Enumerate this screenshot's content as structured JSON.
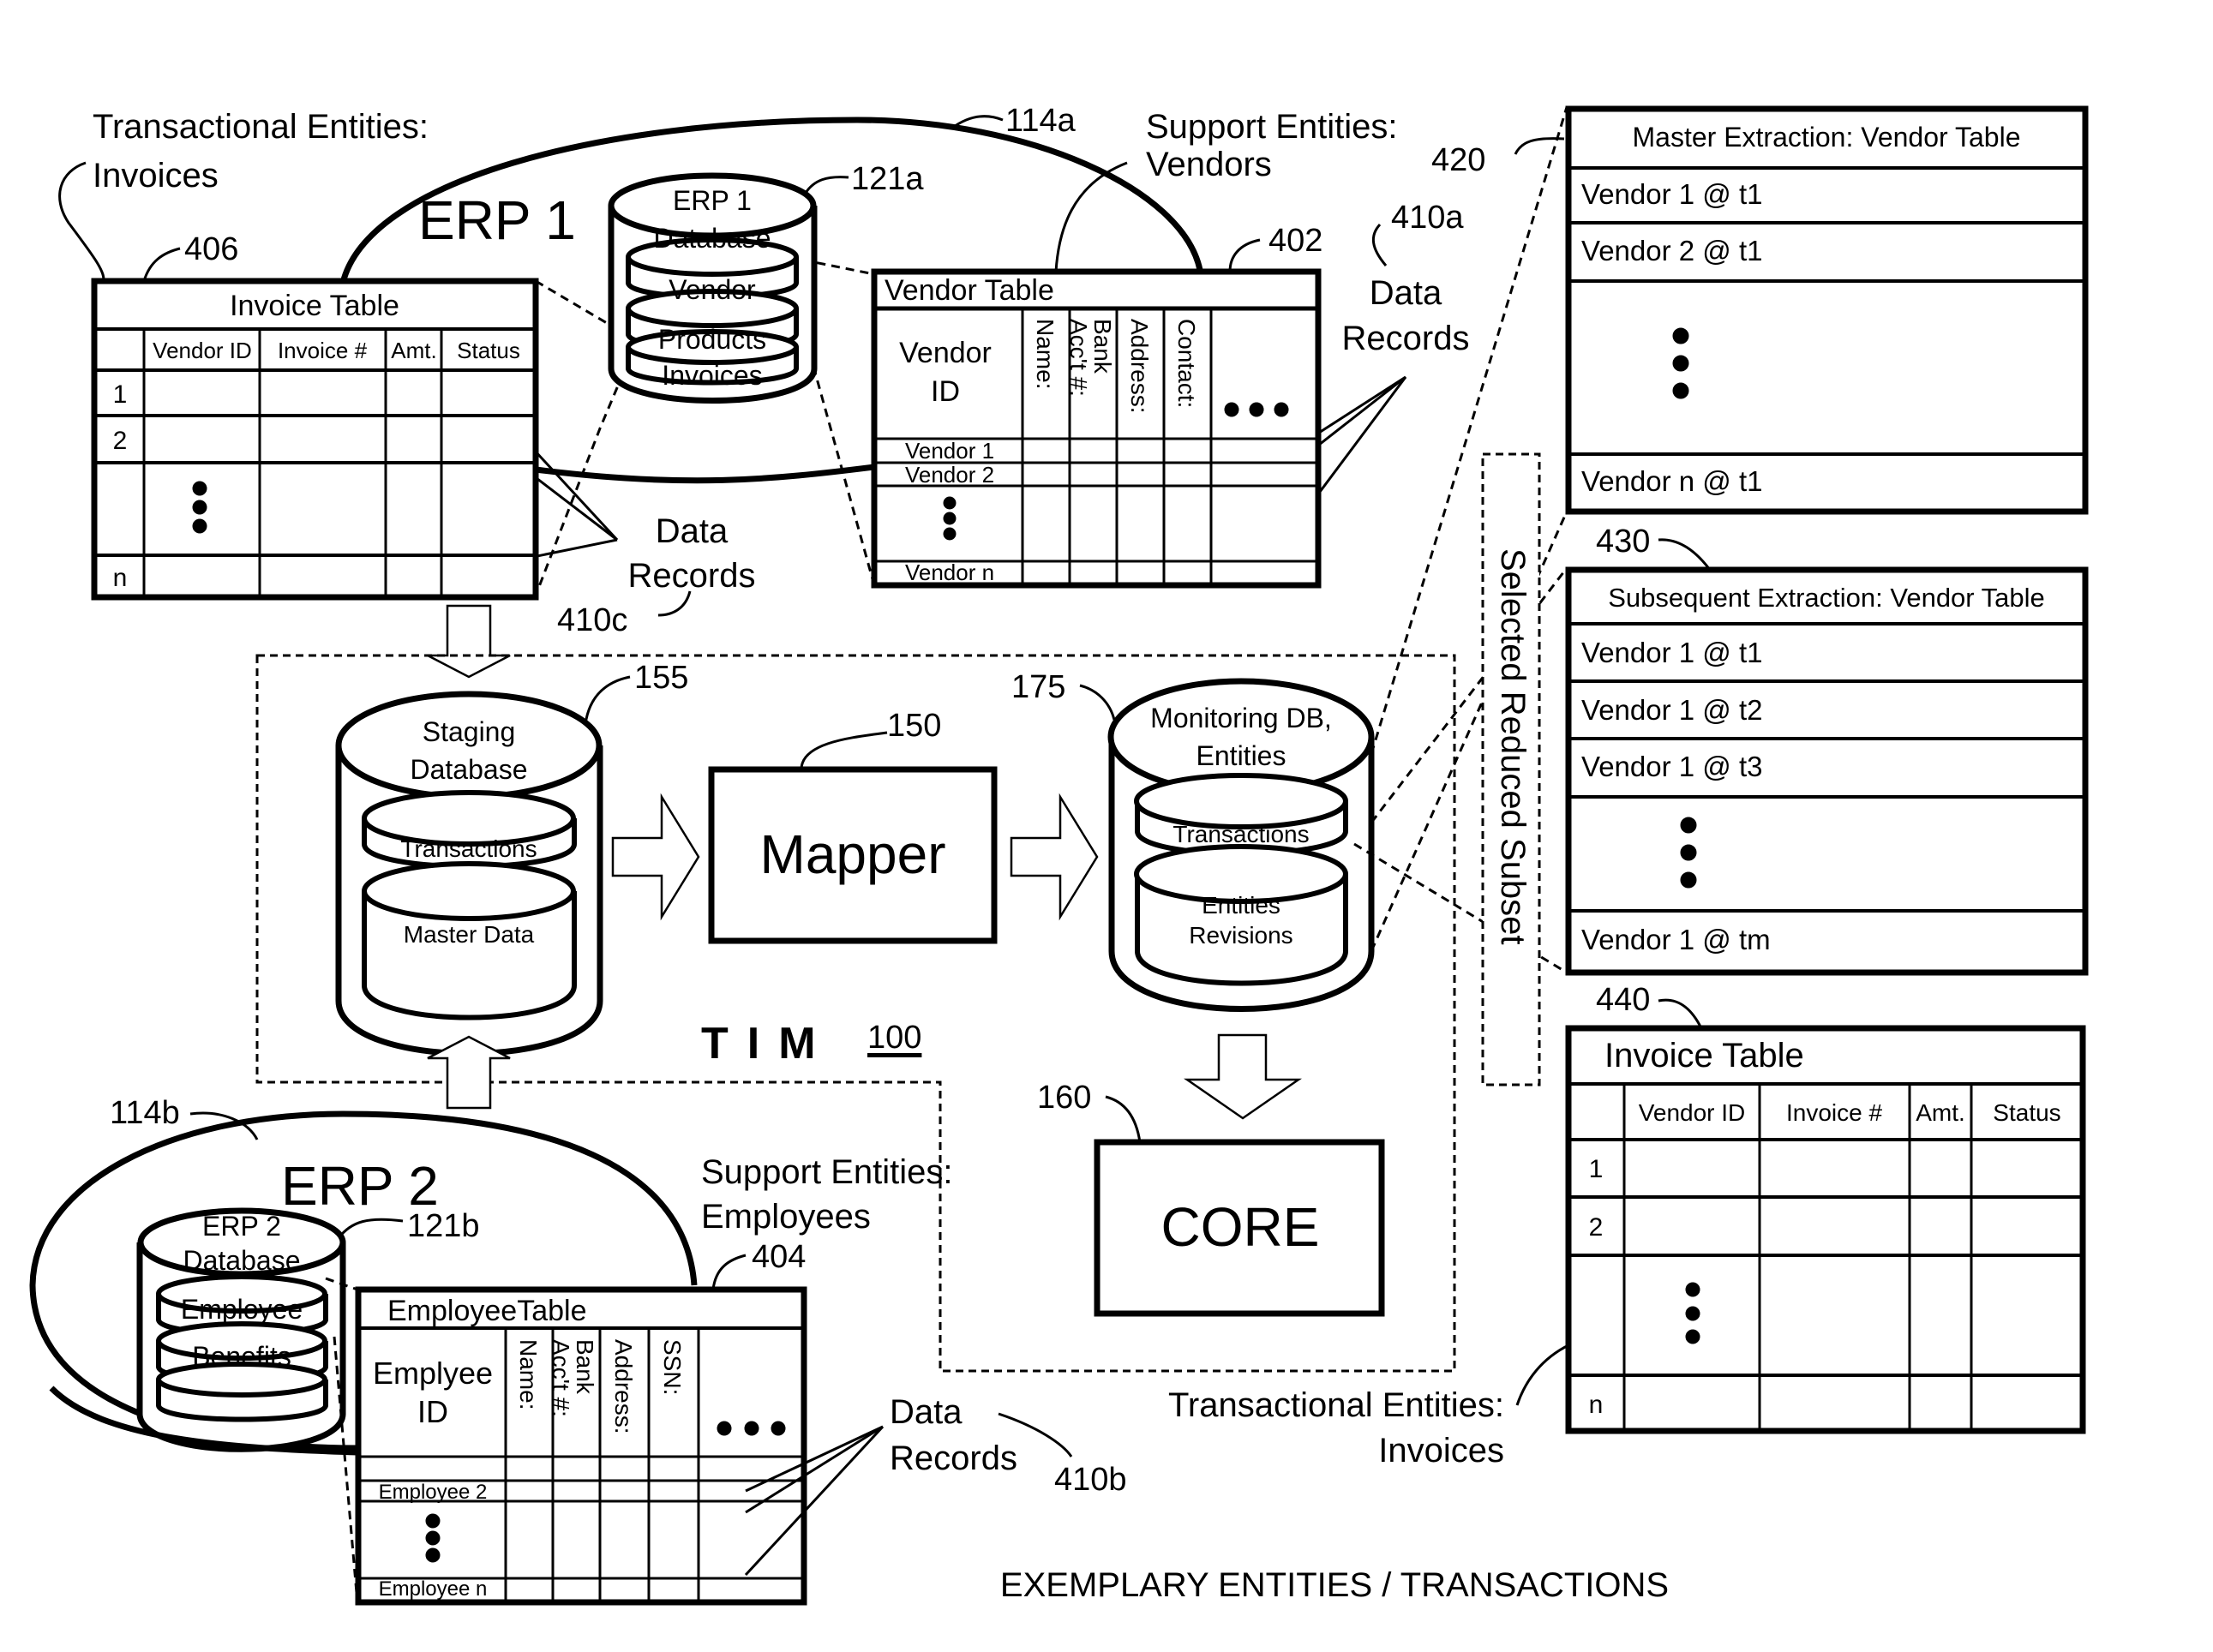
{
  "figure": {
    "caption": "EXEMPLARY ENTITIES / TRANSACTIONS"
  },
  "erp1": {
    "title": "ERP 1",
    "ref": "114a",
    "transactional_label_line1": "Transactional Entities:",
    "transactional_label_line2": "Invoices",
    "support_label_line1": "Support Entities:",
    "support_label_line2": "Vendors",
    "database": {
      "ref": "121a",
      "title_line1": "ERP 1",
      "title_line2": "Database",
      "layers": [
        "Vendor",
        "Products",
        "Invoices"
      ]
    },
    "invoice_table": {
      "ref": "406",
      "title": "Invoice Table",
      "columns": [
        "Vendor ID",
        "Invoice #",
        "Amt.",
        "Status"
      ],
      "row_labels": [
        "1",
        "2",
        "n"
      ]
    },
    "vendor_table": {
      "ref": "402",
      "title": "Vendor Table",
      "id_header_line1": "Vendor",
      "id_header_line2": "ID",
      "columns": [
        "Name:",
        "Bank Acc't #:",
        "Address:",
        "Contact:"
      ],
      "rows": [
        "Vendor 1",
        "Vendor 2",
        "Vendor n"
      ]
    },
    "data_records_a": {
      "line1": "Data",
      "line2": "Records",
      "ref": "410a"
    },
    "data_records_c": {
      "line1": "Data",
      "line2": "Records",
      "ref": "410c"
    }
  },
  "erp2": {
    "title": "ERP 2",
    "ref": "114b",
    "support_label_line1": "Support Entities:",
    "support_label_line2": "Employees",
    "database": {
      "ref": "121b",
      "title_line1": "ERP 2",
      "title_line2": "Database",
      "layers": [
        "Employee",
        "Benefits",
        ""
      ]
    },
    "employee_table": {
      "ref": "404",
      "title": "EmployeeTable",
      "id_header_line1": "Emplyee",
      "id_header_line2": "ID",
      "columns": [
        "Name:",
        "Bank Acc't #:",
        "Address:",
        "SSN:"
      ],
      "rows": [
        "",
        "Employee 2",
        "Employee n"
      ]
    },
    "data_records_b": {
      "line1": "Data",
      "line2": "Records",
      "ref": "410b"
    }
  },
  "tim": {
    "title": "TIM",
    "ref": "100",
    "staging_db": {
      "ref": "155",
      "title_line1": "Staging",
      "title_line2": "Database",
      "layers": [
        "Transactions",
        "Master Data"
      ]
    },
    "mapper": {
      "ref": "150",
      "label": "Mapper"
    },
    "monitoring_db": {
      "ref": "175",
      "title_line1": "Monitoring DB,",
      "title_line2": "Entities",
      "layers": [
        "Transactions",
        "Entities",
        "Revisions"
      ]
    }
  },
  "core": {
    "ref": "160",
    "label": "CORE"
  },
  "selected_subset": {
    "label": "Selected Reduced Subset"
  },
  "master_extraction": {
    "ref": "420",
    "title": "Master Extraction: Vendor Table",
    "rows": [
      "Vendor 1 @ t1",
      "Vendor 2 @ t1",
      "Vendor n @ t1"
    ]
  },
  "subsequent_extraction": {
    "ref": "430",
    "title": "Subsequent Extraction: Vendor Table",
    "rows": [
      "Vendor 1 @ t1",
      "Vendor 1 @ t2",
      "Vendor 1 @ t3",
      "Vendor 1 @ tm"
    ]
  },
  "invoice_table_440": {
    "ref": "440",
    "title": "Invoice Table",
    "columns": [
      "Vendor ID",
      "Invoice #",
      "Amt.",
      "Status"
    ],
    "row_labels": [
      "1",
      "2",
      "n"
    ],
    "label_line1": "Transactional Entities:",
    "label_line2": "Invoices"
  }
}
